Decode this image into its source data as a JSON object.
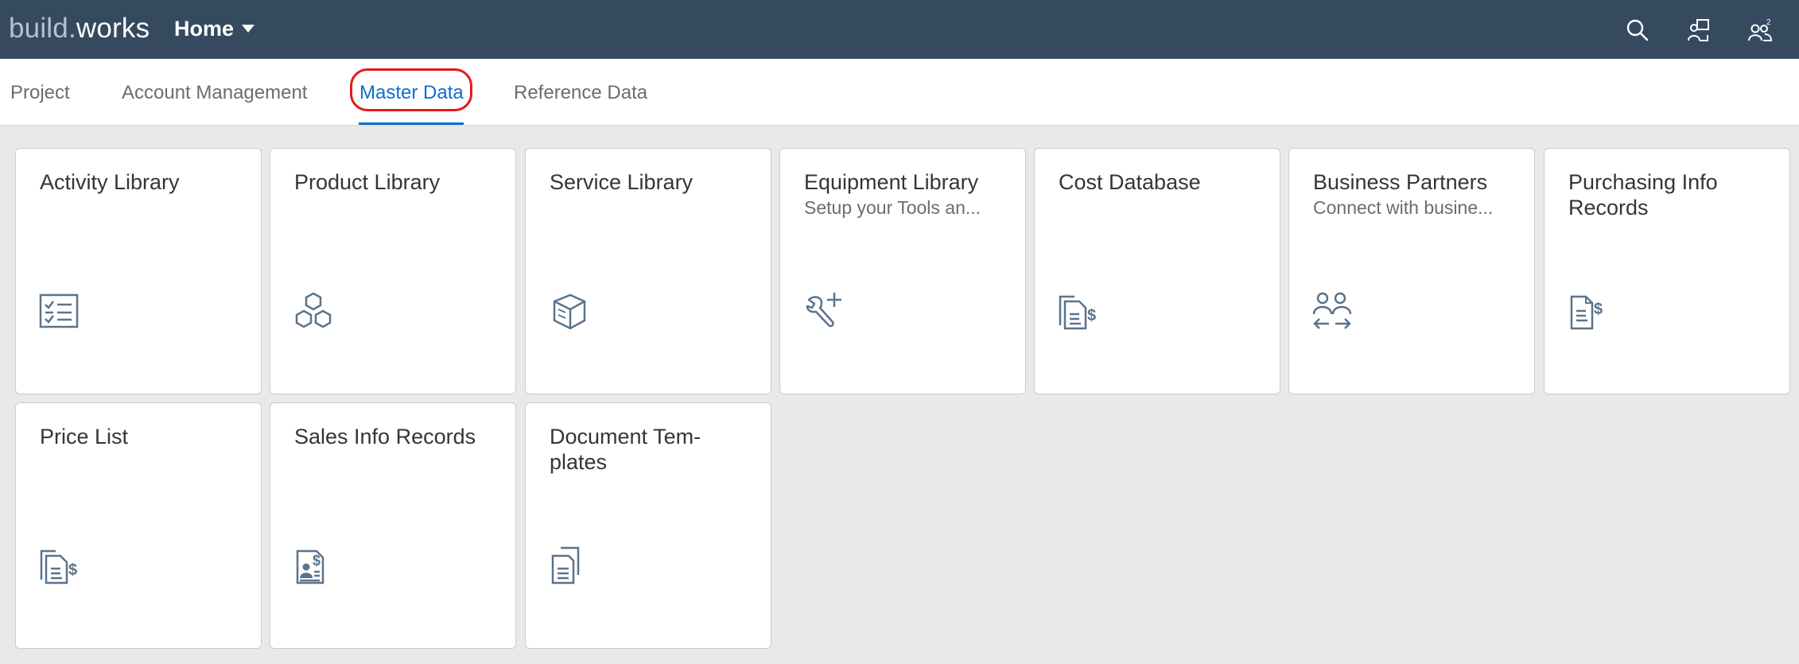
{
  "app": {
    "logo_part1": "build",
    "logo_dot": ".",
    "logo_part2": "works",
    "home_label": "Home"
  },
  "shell_icons": [
    "search-icon",
    "feedback-icon",
    "user-settings-icon"
  ],
  "tabs": [
    {
      "label": "Project",
      "selected": false
    },
    {
      "label": "Account Management",
      "selected": false
    },
    {
      "label": "Master Data",
      "selected": true
    },
    {
      "label": "Reference Data",
      "selected": false
    }
  ],
  "tiles": [
    {
      "title": "Activity Library",
      "subtitle": "",
      "icon": "checklist-icon"
    },
    {
      "title": "Product Library",
      "subtitle": "",
      "icon": "product-cubes-icon"
    },
    {
      "title": "Service Library",
      "subtitle": "",
      "icon": "service-package-icon"
    },
    {
      "title": "Equipment Library",
      "subtitle": "Setup your Tools an...",
      "icon": "wrench-add-icon"
    },
    {
      "title": "Cost Database",
      "subtitle": "",
      "icon": "cost-documents-icon"
    },
    {
      "title": "Business Partners",
      "subtitle": "Connect with busine...",
      "icon": "partners-exchange-icon"
    },
    {
      "title": "Purchasing Info Records",
      "subtitle": "",
      "icon": "purchase-document-icon"
    },
    {
      "title": "Price List",
      "subtitle": "",
      "icon": "price-list-icon"
    },
    {
      "title": "Sales Info Records",
      "subtitle": "",
      "icon": "sales-record-icon"
    },
    {
      "title": "Document Tem-plates",
      "subtitle": "",
      "icon": "document-templates-icon"
    }
  ],
  "colors": {
    "shell": "#354a5f",
    "accent": "#0a6ed1",
    "icon": "#5b738b",
    "highlight": "#e41a1a"
  }
}
